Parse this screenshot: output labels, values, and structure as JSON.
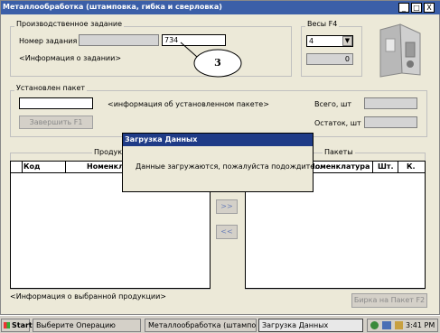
{
  "window": {
    "title": "Металлообработка (штамповка, гибка и сверловка)",
    "controls": [
      "_",
      "□",
      "X"
    ]
  },
  "production_task": {
    "group_label": "Производственное задание",
    "task_number_label": "Номер задания",
    "task_number_value": "734",
    "task_info": "<Информация о задании>",
    "callout_number": "3"
  },
  "scales": {
    "group_label": "Весы  F4",
    "selected": "4",
    "weight_value": "0"
  },
  "package": {
    "group_label": "Установлен пакет",
    "package_info": "<информация об установленном пакете>",
    "total_label": "Всего, шт",
    "remaining_label": "Остаток, шт",
    "finish_button": "Завершить    F1"
  },
  "products_table": {
    "section_label": "Продукция",
    "columns": [
      "Код",
      "Номенклатура"
    ]
  },
  "packages_table": {
    "section_label": "Пакеты",
    "columns": [
      "Номенклатура",
      "Шт.",
      "К."
    ]
  },
  "transfer": {
    "right_button": ">>",
    "left_button": "<<"
  },
  "footer": {
    "selected_product_info": "<Информация о выбранной продукции>",
    "tag_button": "Бирка на Пакет   F2"
  },
  "dialog": {
    "title": "Загрузка Данных",
    "message": "Данные загружаются, пожалуйста подождите..."
  },
  "taskbar": {
    "start": "Start",
    "items": [
      "Выберите Операцию",
      "Металлообработка (штамповка, ...",
      "Загрузка Данных"
    ],
    "time": "3:41 PM"
  }
}
